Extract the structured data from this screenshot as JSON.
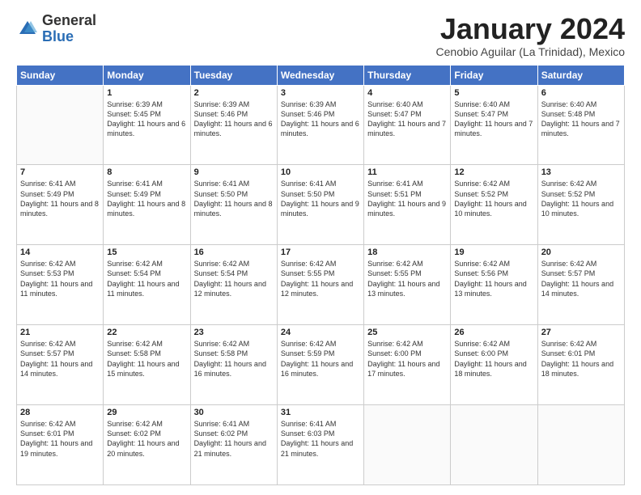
{
  "logo": {
    "general": "General",
    "blue": "Blue"
  },
  "header": {
    "title": "January 2024",
    "subtitle": "Cenobio Aguilar (La Trinidad), Mexico"
  },
  "weekdays": [
    "Sunday",
    "Monday",
    "Tuesday",
    "Wednesday",
    "Thursday",
    "Friday",
    "Saturday"
  ],
  "weeks": [
    [
      {
        "day": "",
        "sunrise": "",
        "sunset": "",
        "daylight": ""
      },
      {
        "day": "1",
        "sunrise": "Sunrise: 6:39 AM",
        "sunset": "Sunset: 5:45 PM",
        "daylight": "Daylight: 11 hours and 6 minutes."
      },
      {
        "day": "2",
        "sunrise": "Sunrise: 6:39 AM",
        "sunset": "Sunset: 5:46 PM",
        "daylight": "Daylight: 11 hours and 6 minutes."
      },
      {
        "day": "3",
        "sunrise": "Sunrise: 6:39 AM",
        "sunset": "Sunset: 5:46 PM",
        "daylight": "Daylight: 11 hours and 6 minutes."
      },
      {
        "day": "4",
        "sunrise": "Sunrise: 6:40 AM",
        "sunset": "Sunset: 5:47 PM",
        "daylight": "Daylight: 11 hours and 7 minutes."
      },
      {
        "day": "5",
        "sunrise": "Sunrise: 6:40 AM",
        "sunset": "Sunset: 5:47 PM",
        "daylight": "Daylight: 11 hours and 7 minutes."
      },
      {
        "day": "6",
        "sunrise": "Sunrise: 6:40 AM",
        "sunset": "Sunset: 5:48 PM",
        "daylight": "Daylight: 11 hours and 7 minutes."
      }
    ],
    [
      {
        "day": "7",
        "sunrise": "Sunrise: 6:41 AM",
        "sunset": "Sunset: 5:49 PM",
        "daylight": "Daylight: 11 hours and 8 minutes."
      },
      {
        "day": "8",
        "sunrise": "Sunrise: 6:41 AM",
        "sunset": "Sunset: 5:49 PM",
        "daylight": "Daylight: 11 hours and 8 minutes."
      },
      {
        "day": "9",
        "sunrise": "Sunrise: 6:41 AM",
        "sunset": "Sunset: 5:50 PM",
        "daylight": "Daylight: 11 hours and 8 minutes."
      },
      {
        "day": "10",
        "sunrise": "Sunrise: 6:41 AM",
        "sunset": "Sunset: 5:50 PM",
        "daylight": "Daylight: 11 hours and 9 minutes."
      },
      {
        "day": "11",
        "sunrise": "Sunrise: 6:41 AM",
        "sunset": "Sunset: 5:51 PM",
        "daylight": "Daylight: 11 hours and 9 minutes."
      },
      {
        "day": "12",
        "sunrise": "Sunrise: 6:42 AM",
        "sunset": "Sunset: 5:52 PM",
        "daylight": "Daylight: 11 hours and 10 minutes."
      },
      {
        "day": "13",
        "sunrise": "Sunrise: 6:42 AM",
        "sunset": "Sunset: 5:52 PM",
        "daylight": "Daylight: 11 hours and 10 minutes."
      }
    ],
    [
      {
        "day": "14",
        "sunrise": "Sunrise: 6:42 AM",
        "sunset": "Sunset: 5:53 PM",
        "daylight": "Daylight: 11 hours and 11 minutes."
      },
      {
        "day": "15",
        "sunrise": "Sunrise: 6:42 AM",
        "sunset": "Sunset: 5:54 PM",
        "daylight": "Daylight: 11 hours and 11 minutes."
      },
      {
        "day": "16",
        "sunrise": "Sunrise: 6:42 AM",
        "sunset": "Sunset: 5:54 PM",
        "daylight": "Daylight: 11 hours and 12 minutes."
      },
      {
        "day": "17",
        "sunrise": "Sunrise: 6:42 AM",
        "sunset": "Sunset: 5:55 PM",
        "daylight": "Daylight: 11 hours and 12 minutes."
      },
      {
        "day": "18",
        "sunrise": "Sunrise: 6:42 AM",
        "sunset": "Sunset: 5:55 PM",
        "daylight": "Daylight: 11 hours and 13 minutes."
      },
      {
        "day": "19",
        "sunrise": "Sunrise: 6:42 AM",
        "sunset": "Sunset: 5:56 PM",
        "daylight": "Daylight: 11 hours and 13 minutes."
      },
      {
        "day": "20",
        "sunrise": "Sunrise: 6:42 AM",
        "sunset": "Sunset: 5:57 PM",
        "daylight": "Daylight: 11 hours and 14 minutes."
      }
    ],
    [
      {
        "day": "21",
        "sunrise": "Sunrise: 6:42 AM",
        "sunset": "Sunset: 5:57 PM",
        "daylight": "Daylight: 11 hours and 14 minutes."
      },
      {
        "day": "22",
        "sunrise": "Sunrise: 6:42 AM",
        "sunset": "Sunset: 5:58 PM",
        "daylight": "Daylight: 11 hours and 15 minutes."
      },
      {
        "day": "23",
        "sunrise": "Sunrise: 6:42 AM",
        "sunset": "Sunset: 5:58 PM",
        "daylight": "Daylight: 11 hours and 16 minutes."
      },
      {
        "day": "24",
        "sunrise": "Sunrise: 6:42 AM",
        "sunset": "Sunset: 5:59 PM",
        "daylight": "Daylight: 11 hours and 16 minutes."
      },
      {
        "day": "25",
        "sunrise": "Sunrise: 6:42 AM",
        "sunset": "Sunset: 6:00 PM",
        "daylight": "Daylight: 11 hours and 17 minutes."
      },
      {
        "day": "26",
        "sunrise": "Sunrise: 6:42 AM",
        "sunset": "Sunset: 6:00 PM",
        "daylight": "Daylight: 11 hours and 18 minutes."
      },
      {
        "day": "27",
        "sunrise": "Sunrise: 6:42 AM",
        "sunset": "Sunset: 6:01 PM",
        "daylight": "Daylight: 11 hours and 18 minutes."
      }
    ],
    [
      {
        "day": "28",
        "sunrise": "Sunrise: 6:42 AM",
        "sunset": "Sunset: 6:01 PM",
        "daylight": "Daylight: 11 hours and 19 minutes."
      },
      {
        "day": "29",
        "sunrise": "Sunrise: 6:42 AM",
        "sunset": "Sunset: 6:02 PM",
        "daylight": "Daylight: 11 hours and 20 minutes."
      },
      {
        "day": "30",
        "sunrise": "Sunrise: 6:41 AM",
        "sunset": "Sunset: 6:02 PM",
        "daylight": "Daylight: 11 hours and 21 minutes."
      },
      {
        "day": "31",
        "sunrise": "Sunrise: 6:41 AM",
        "sunset": "Sunset: 6:03 PM",
        "daylight": "Daylight: 11 hours and 21 minutes."
      },
      {
        "day": "",
        "sunrise": "",
        "sunset": "",
        "daylight": ""
      },
      {
        "day": "",
        "sunrise": "",
        "sunset": "",
        "daylight": ""
      },
      {
        "day": "",
        "sunrise": "",
        "sunset": "",
        "daylight": ""
      }
    ]
  ]
}
